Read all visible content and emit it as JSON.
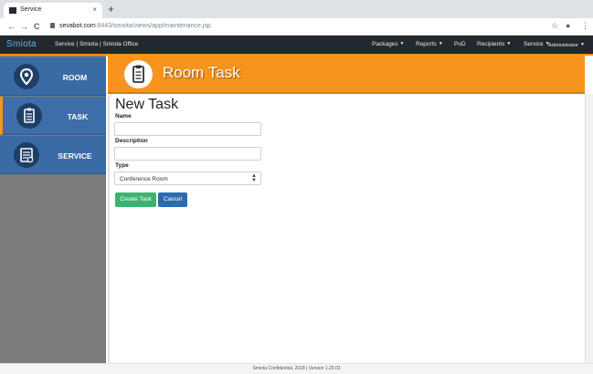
{
  "browser": {
    "tab_title": "Service",
    "tab_close": "×",
    "new_tab": "+",
    "back": "←",
    "forward": "→",
    "reload": "C",
    "url_host": "sevabot.com",
    "url_path": ":8443/smiota/views/app/maintenance.jsp",
    "star": "☆",
    "account": "●",
    "menu": "⋮"
  },
  "appnav": {
    "brand": "Smiota",
    "breadcrumb": "Service | Smiota | Smiota Office",
    "packages": "Packages",
    "reports": "Reports",
    "pod": "PoD",
    "recipients": "Recipients",
    "service": "Service",
    "user": "Administrator"
  },
  "sidebar": {
    "items": [
      {
        "label": "ROOM",
        "icon": "location-pin-icon"
      },
      {
        "label": "TASK",
        "icon": "clipboard-icon"
      },
      {
        "label": "SERVICE",
        "icon": "service-list-icon"
      }
    ]
  },
  "header": {
    "title": "Room Task",
    "icon": "clipboard-icon",
    "color": "#f7941d"
  },
  "form": {
    "heading": "New Task",
    "name_label": "Name",
    "name_value": "",
    "description_label": "Description",
    "description_value": "",
    "type_label": "Type",
    "type_selected": "Conference Room",
    "create_label": "Create Task",
    "cancel_label": "Cancel"
  },
  "footer": {
    "text": "Smiota Confidential, 2018 | Version 1.20.03"
  },
  "colors": {
    "accent": "#f7941d",
    "sidebar_blue": "#3b6ba5",
    "navbar": "#23282f",
    "create_button": "#3cb371",
    "cancel_button": "#2b6cb0"
  }
}
